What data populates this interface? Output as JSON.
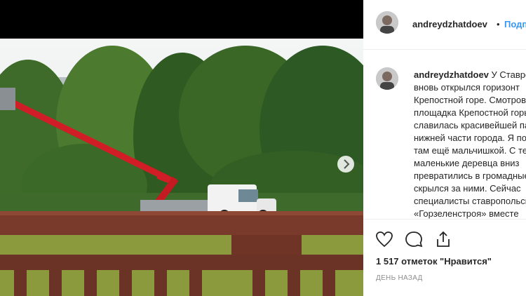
{
  "post": {
    "username": "andreydzhatdoev",
    "separator": "•",
    "follow_label": "Подписаться",
    "caption_username": "andreydzhatdoev",
    "caption_lines": [
      "У Ставрополе",
      "вновь открылся горизонт",
      "Крепостной горе. Смотровая",
      "площадка Крепостной горы",
      "славилась красивейшей панорамой",
      "нижней части города. Я помню",
      "там ещё мальчишкой. С тех пор",
      "маленькие деревца вниз",
      "превратились в громадные деревья",
      "скрылся за ними. Сейчас",
      "специалисты ставропольского",
      "«Горзеленстроя» вместе"
    ],
    "likes": "1 517 отметок \"Нравится\"",
    "time": "ДЕНЬ НАЗАД"
  },
  "icons": {
    "like": "heart-icon",
    "comment": "comment-icon",
    "share": "share-icon",
    "next": "chevron-right-icon"
  },
  "colors": {
    "accent": "#3897f0",
    "text": "#262626",
    "muted": "#8e8e8e"
  }
}
